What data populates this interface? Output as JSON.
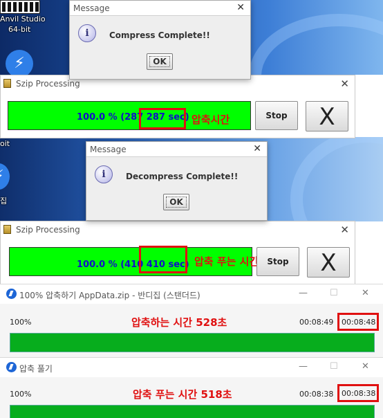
{
  "desktop": {
    "icon_label_1": "Anvil Studio",
    "icon_label_2": "64-bit",
    "icon_label_3": "oit",
    "icon_label_4": "집"
  },
  "dialogs": [
    {
      "title": "Message",
      "message": "Compress Complete!!",
      "ok": "OK",
      "close": "✕"
    },
    {
      "title": "Message",
      "message": "Decompress Complete!!",
      "ok": "OK",
      "close": "✕"
    }
  ],
  "szip_windows": [
    {
      "title": "Szip Processing",
      "progress_text": "100.0 %   (287 287 sec)",
      "progress_value": 1.0,
      "stop": "Stop",
      "x": "X",
      "close": "✕",
      "annotation": "압축시간"
    },
    {
      "title": "Szip Processing",
      "progress_text": "100.0 %   (410 410 sec)",
      "progress_value": 1.0,
      "stop": "Stop",
      "x": "X",
      "close": "✕",
      "annotation": "압축 푸는 시간"
    }
  ],
  "bandizip_windows": [
    {
      "title": "100% 압축하기 AppData.zip - 반디집 (스탠더드)",
      "percent": "100%",
      "elapsed": "00:08:49",
      "remaining": "00:08:48",
      "progress_value": 1.0,
      "annotation": "압축하는 시간 528초",
      "min": "—",
      "max": "☐",
      "close": "✕"
    },
    {
      "title": "압축 풀기",
      "percent": "100%",
      "elapsed": "00:08:38",
      "remaining": "00:08:38",
      "progress_value": 1.0,
      "annotation": "압축 푸는 시간 518초",
      "min": "—",
      "max": "☐",
      "close": "✕"
    }
  ],
  "colors": {
    "szip_progress": "#00ff00",
    "szip_text": "#1010c8",
    "bandizip_progress": "#07ad1d",
    "annotation_red": "#e01010"
  }
}
